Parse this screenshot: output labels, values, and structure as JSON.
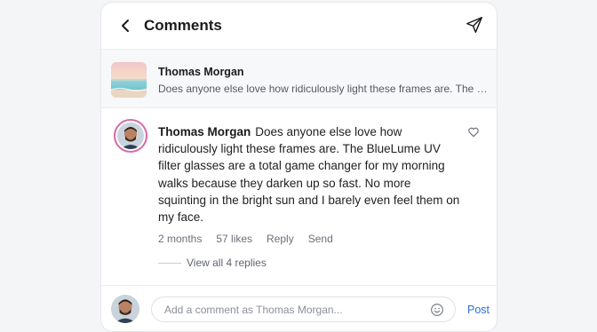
{
  "header": {
    "title": "Comments",
    "back_icon": "chevron-left-icon",
    "share_icon": "send-icon"
  },
  "preview": {
    "author": "Thomas Morgan",
    "text": "Does anyone else love how ridiculously light these frames are. The BlueLume UV filter glasses are a total game changer for my morning walks because they darken up so fast. No more squinting in the bright sun and I barely even feel them on my face."
  },
  "comment": {
    "author": "Thomas Morgan",
    "text": "Does anyone else love how ridiculously light these frames are. The BlueLume UV filter glasses are a total game changer for my morning walks because they darken up so fast. No more squinting in the bright sun and I barely even feel them on my face.",
    "time": "2 months",
    "likes": "57 likes",
    "reply_label": "Reply",
    "send_label": "Send",
    "view_replies": "View all 4 replies",
    "like_icon": "heart-icon"
  },
  "footer": {
    "placeholder": "Add a comment as Thomas Morgan...",
    "post_label": "Post",
    "emoji_icon": "smiley-icon"
  },
  "colors": {
    "accent": "#2d6fd6",
    "avatar_ring": "#d66aa8",
    "preview_bg": "#f7f8fa"
  }
}
